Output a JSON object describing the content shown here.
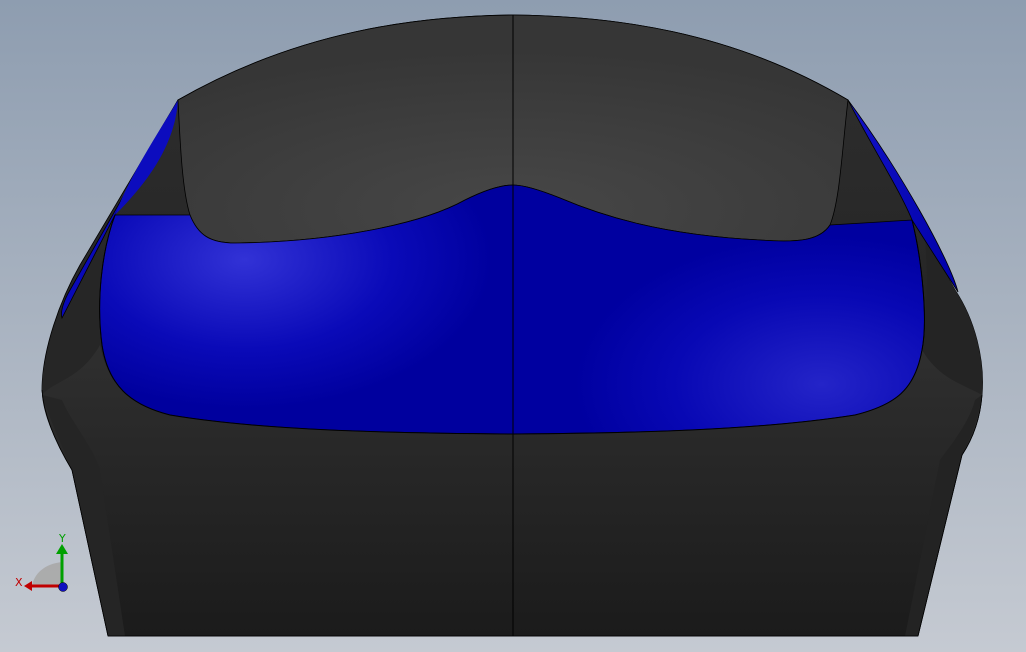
{
  "viewport": {
    "background_top": "#8e9db0",
    "background_bottom": "#c5cad2"
  },
  "model": {
    "body_color": "#2b2b2b",
    "body_color_dark": "#1d1d1d",
    "top_color": "#3c3c3c",
    "face_color": "#0a0acc",
    "face_highlight": "#2f2fd8",
    "face_shadow": "#0000a6",
    "edge_color": "#000000"
  },
  "triad": {
    "x_label": "X",
    "y_label": "Y",
    "x_color": "#c00000",
    "y_color": "#00a000",
    "z_color": "#0000c0"
  }
}
